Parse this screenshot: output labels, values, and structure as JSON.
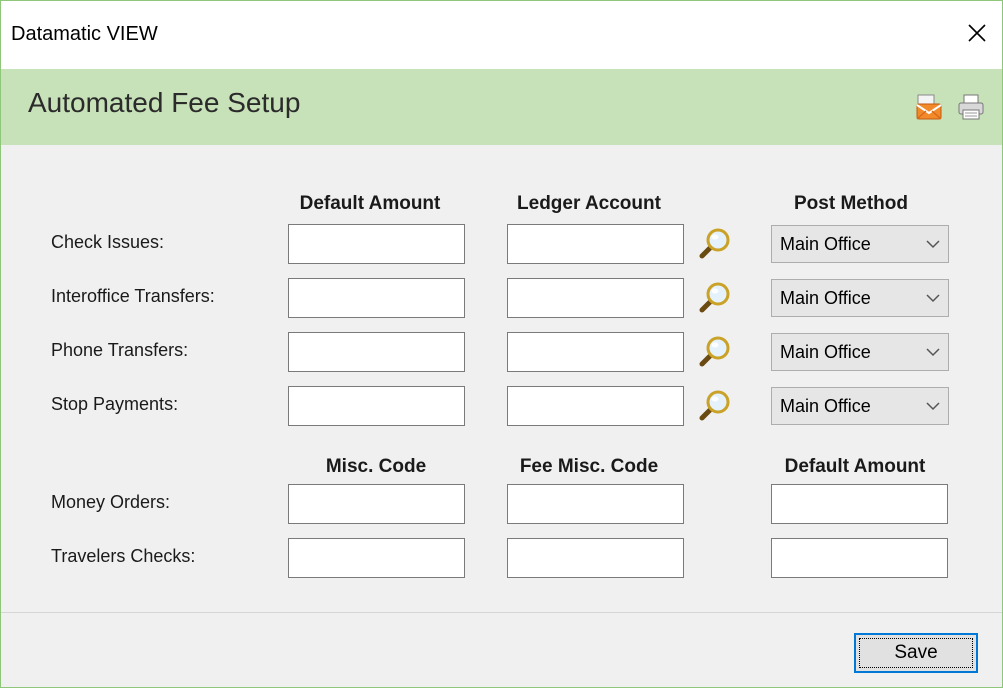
{
  "window": {
    "title": "Datamatic VIEW",
    "close_icon": "close-icon"
  },
  "header": {
    "title": "Automated Fee Setup",
    "icons": [
      "mail-icon",
      "print-icon"
    ]
  },
  "fees": {
    "headers": {
      "default_amount": "Default Amount",
      "ledger_account": "Ledger Account",
      "post_method": "Post Method"
    },
    "rows": [
      {
        "label": "Check Issues:",
        "default_amount": "",
        "ledger_account": "",
        "post_method": "Main Office"
      },
      {
        "label": "Interoffice Transfers:",
        "default_amount": "",
        "ledger_account": "",
        "post_method": "Main Office"
      },
      {
        "label": "Phone Transfers:",
        "default_amount": "",
        "ledger_account": "",
        "post_method": "Main Office"
      },
      {
        "label": "Stop Payments:",
        "default_amount": "",
        "ledger_account": "",
        "post_method": "Main Office"
      }
    ]
  },
  "misc": {
    "headers": {
      "misc_code": "Misc. Code",
      "fee_misc_code": "Fee Misc. Code",
      "default_amount": "Default Amount"
    },
    "rows": [
      {
        "label": "Money Orders:",
        "misc_code": "",
        "fee_misc_code": "",
        "default_amount": ""
      },
      {
        "label": "Travelers Checks:",
        "misc_code": "",
        "fee_misc_code": "",
        "default_amount": ""
      }
    ]
  },
  "footer": {
    "save_label": "Save"
  },
  "colors": {
    "header_bg": "#c7e1b8",
    "window_border": "#8fc77a",
    "focus_border": "#0078d7"
  }
}
